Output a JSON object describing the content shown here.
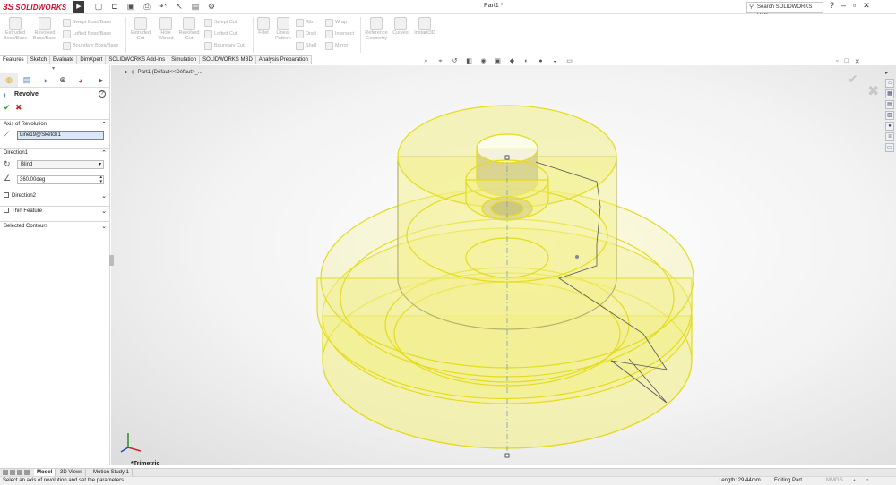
{
  "app": {
    "logo_mark": "3S",
    "logo_text": "SOLIDWORKS",
    "document_title": "Part1 *",
    "help_search_placeholder": "Search SOLIDWORKS Help"
  },
  "ribbon": {
    "buttons": [
      {
        "label": "Extruded Boss/Base"
      },
      {
        "label": "Revolved Boss/Base"
      },
      {
        "label": "Extruded Cut"
      },
      {
        "label": "Hole Wizard"
      },
      {
        "label": "Revolved Cut"
      },
      {
        "label": "Fillet"
      },
      {
        "label": "Linear Pattern"
      },
      {
        "label": "Reference Geometry"
      },
      {
        "label": "Curves"
      },
      {
        "label": "Instant3D"
      }
    ],
    "small_buttons": [
      {
        "label": "Swept Boss/Base"
      },
      {
        "label": "Lofted Boss/Base"
      },
      {
        "label": "Boundary Boss/Base"
      },
      {
        "label": "Swept Cut"
      },
      {
        "label": "Lofted Cut"
      },
      {
        "label": "Boundary Cut"
      },
      {
        "label": "Rib"
      },
      {
        "label": "Draft"
      },
      {
        "label": "Shell"
      },
      {
        "label": "Wrap"
      },
      {
        "label": "Intersect"
      },
      {
        "label": "Mirror"
      }
    ]
  },
  "tabs": [
    "Features",
    "Sketch",
    "Evaluate",
    "DimXpert",
    "SOLIDWORKS Add-Ins",
    "Simulation",
    "SOLIDWORKS MBD",
    "Analysis Preparation"
  ],
  "property_manager": {
    "title": "Revolve",
    "axis_section": "Axis of Revolution",
    "axis_value": "Line19@Sketch1",
    "direction1_section": "Direction1",
    "end_condition": "Blind",
    "angle": "360.00deg",
    "direction2": "Direction2",
    "thin_feature": "Thin Feature",
    "selected_contours": "Selected Contours"
  },
  "feature_tree": {
    "root": "Part1  (Défaut<<Défaut>_..."
  },
  "viewport": {
    "view_orientation": "*Trimetric"
  },
  "bottom_tabs": [
    "Model",
    "3D Views",
    "Motion Study 1"
  ],
  "status": {
    "message": "Select an axis of revolution and set the parameters.",
    "length": "Length: 29.44mm",
    "mode": "Editing Part",
    "units": "MMGS"
  },
  "colors": {
    "brand": "#c8102e",
    "part_fill": "#f3ef8a",
    "part_edge": "#e3dc1e",
    "ok_green": "#2e9e2e",
    "cancel_red": "#c62828"
  }
}
